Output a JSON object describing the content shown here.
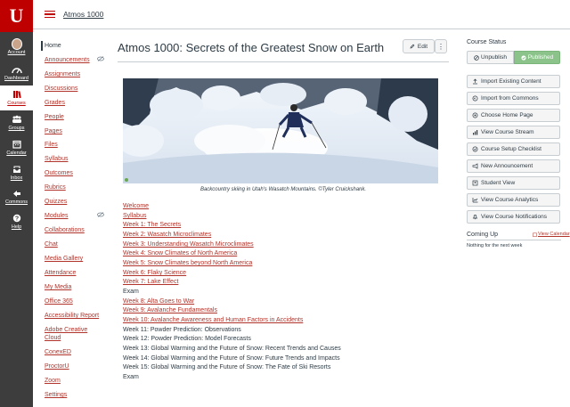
{
  "global_nav": {
    "logo": "U",
    "items": [
      {
        "label": "Account",
        "icon": "avatar",
        "active": false
      },
      {
        "label": "Dashboard",
        "icon": "dashboard-icon",
        "active": false
      },
      {
        "label": "Courses",
        "icon": "courses-icon",
        "active": true
      },
      {
        "label": "Groups",
        "icon": "groups-icon",
        "active": false
      },
      {
        "label": "Calendar",
        "icon": "calendar-icon",
        "active": false
      },
      {
        "label": "Inbox",
        "icon": "inbox-icon",
        "active": false
      },
      {
        "label": "Commons",
        "icon": "commons-icon",
        "active": false
      },
      {
        "label": "Help",
        "icon": "help-icon",
        "active": false
      }
    ]
  },
  "header": {
    "breadcrumb": "Atmos 1000"
  },
  "course_nav": [
    {
      "label": "Home"
    },
    {
      "label": "Announcements"
    },
    {
      "label": "Assignments"
    },
    {
      "label": "Discussions"
    },
    {
      "label": "Grades"
    },
    {
      "label": "People"
    },
    {
      "label": "Pages"
    },
    {
      "label": "Files"
    },
    {
      "label": "Syllabus"
    },
    {
      "label": "Outcomes"
    },
    {
      "label": "Rubrics"
    },
    {
      "label": "Quizzes"
    },
    {
      "label": "Modules"
    },
    {
      "label": "Collaborations"
    },
    {
      "label": "Chat"
    },
    {
      "label": "Media Gallery"
    },
    {
      "label": "Attendance"
    },
    {
      "label": "My Media"
    },
    {
      "label": "Office 365"
    },
    {
      "label": "Accessibility Report"
    },
    {
      "label": "Adobe Creative Cloud"
    },
    {
      "label": "ConexED"
    },
    {
      "label": "ProctorU"
    },
    {
      "label": "Zoom"
    },
    {
      "label": "Settings"
    }
  ],
  "main": {
    "title": "Atmos 1000: Secrets of the Greatest Snow on Earth",
    "edit_label": "Edit",
    "more_label": "⋮",
    "caption": "Backcountry skiing in Utah's Wasatch Mountains.  ©Tyler Cruickshank.",
    "content": [
      {
        "text": "Welcome",
        "link": true
      },
      {
        "text": "Syllabus",
        "link": true
      },
      {
        "text": "Week 1: The Secrets",
        "link": true
      },
      {
        "text": "Week 2: Wasatch Microclimates",
        "link": true
      },
      {
        "text": "Week 3: Understanding Wasatch Microclimates",
        "link": true
      },
      {
        "text": "Week 4: Snow Climates of North America",
        "link": true
      },
      {
        "text": "Week 5: Snow Climates beyond North America",
        "link": true
      },
      {
        "text": "Week 6: Flaky Science",
        "link": true
      },
      {
        "text": "Week 7: Lake Effect",
        "link": true
      },
      {
        "text": "Exam",
        "link": false
      },
      {
        "text": "Week 8: Alta Goes to War",
        "link": true
      },
      {
        "text": "Week 9: Avalanche Fundamentals",
        "link": true
      },
      {
        "text": "Week 10: Avalanche Awareness and Human Factors in Accidents",
        "link": true
      },
      {
        "text": "Week 11: Powder Prediction: Observations",
        "link": false
      },
      {
        "text": "Week 12: Powder Prediction: Model Forecasts",
        "link": false
      },
      {
        "text": "Week 13: Global Warming and the Future of Snow: Recent Trends and Causes",
        "link": false
      },
      {
        "text": "Week 14: Global Warming and the Future of Snow: Future Trends and Impacts",
        "link": false
      },
      {
        "text": "Week 15: Global Warming and the Future of Snow: The Fate of Ski Resorts",
        "link": false
      },
      {
        "text": "Exam",
        "link": false
      }
    ]
  },
  "sidebar": {
    "status_label": "Course Status",
    "unpublish_label": "Unpublish",
    "published_label": "Published",
    "buttons": [
      {
        "label": "Import Existing Content",
        "icon": "upload-icon"
      },
      {
        "label": "Import from Commons",
        "icon": "commons-icon"
      },
      {
        "label": "Choose Home Page",
        "icon": "target-icon"
      },
      {
        "label": "View Course Stream",
        "icon": "chart-icon"
      },
      {
        "label": "Course Setup Checklist",
        "icon": "check-circle-icon"
      },
      {
        "label": "New Announcement",
        "icon": "megaphone-icon"
      },
      {
        "label": "Student View",
        "icon": "student-icon"
      },
      {
        "label": "View Course Analytics",
        "icon": "analytics-icon"
      },
      {
        "label": "View Course Notifications",
        "icon": "bell-icon"
      }
    ],
    "coming_up": "Coming Up",
    "view_calendar": "View Calendar",
    "nothing": "Nothing for the next week"
  },
  "colors": {
    "brand_red": "#be0000",
    "link_red": "#b0342b",
    "published_green": "#8bc38b",
    "nav_dark": "#3d3d3d"
  }
}
